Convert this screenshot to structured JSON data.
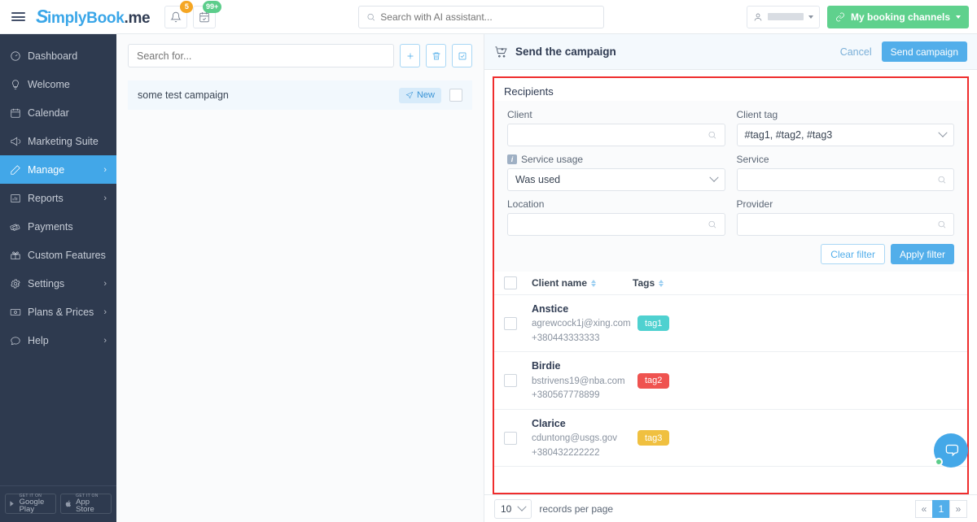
{
  "header": {
    "logo": {
      "s": "S",
      "blue": "imply",
      "bold_blue": "Book",
      "dark": ".me"
    },
    "menu_icon": "hamburger-icon",
    "notifications": {
      "icon": "bell-icon",
      "count": "5"
    },
    "bookings": {
      "icon": "calendar-check-icon",
      "count": "99+"
    },
    "search": {
      "placeholder": "Search with AI assistant...",
      "value": "",
      "icon": "search-icon"
    },
    "user": {
      "icon": "user-icon",
      "name": ""
    },
    "booking_channels": {
      "label": "My booking channels",
      "icon": "link-icon",
      "color": "#5fd18d"
    }
  },
  "sidebar": {
    "items": [
      {
        "label": "Dashboard",
        "icon": "speedometer-icon",
        "has_chevron": false,
        "active": false
      },
      {
        "label": "Welcome",
        "icon": "lightbulb-icon",
        "has_chevron": false,
        "active": false
      },
      {
        "label": "Calendar",
        "icon": "calendar-icon",
        "has_chevron": false,
        "active": false
      },
      {
        "label": "Marketing Suite",
        "icon": "megaphone-icon",
        "has_chevron": false,
        "active": false
      },
      {
        "label": "Manage",
        "icon": "pencil-icon",
        "has_chevron": true,
        "active": true
      },
      {
        "label": "Reports",
        "icon": "bar-chart-icon",
        "has_chevron": true,
        "active": false
      },
      {
        "label": "Payments",
        "icon": "money-icon",
        "has_chevron": false,
        "active": false
      },
      {
        "label": "Custom Features",
        "icon": "gift-icon",
        "has_chevron": false,
        "active": false
      },
      {
        "label": "Settings",
        "icon": "gear-icon",
        "has_chevron": true,
        "active": false
      },
      {
        "label": "Plans & Prices",
        "icon": "banknote-icon",
        "has_chevron": true,
        "active": false
      },
      {
        "label": "Help",
        "icon": "chat-icon",
        "has_chevron": true,
        "active": false
      }
    ],
    "chevron_glyph": "›",
    "stores": [
      {
        "top": "GET IT ON",
        "name": "Google Play",
        "icon": "google-play-icon"
      },
      {
        "top": "GET IT ON",
        "name": "App Store",
        "icon": "apple-icon"
      }
    ],
    "active_color": "#42a7e8",
    "background": "#2e3a4f"
  },
  "campaign_list": {
    "search": {
      "placeholder": "Search for...",
      "value": ""
    },
    "actions": [
      {
        "name": "add-campaign-button",
        "icon": "plus-icon"
      },
      {
        "name": "delete-campaign-button",
        "icon": "trash-icon"
      },
      {
        "name": "select-all-button",
        "icon": "checkbox-square-icon"
      }
    ],
    "rows": [
      {
        "name": "some test campaign",
        "status": "New",
        "status_icon": "paper-plane-icon",
        "checked": false
      }
    ]
  },
  "panel": {
    "icon": "cart-plus-icon",
    "title": "Send the campaign",
    "cancel_label": "Cancel",
    "send_label": "Send campaign",
    "highlight_color": "#ef2d2d"
  },
  "recipients": {
    "title": "Recipients",
    "filters": {
      "client": {
        "label": "Client",
        "value": "",
        "icon": "search-icon"
      },
      "client_tag": {
        "label": "Client tag",
        "value": "#tag1, #tag2, #tag3",
        "icon": "chevron-down-icon"
      },
      "service_usage": {
        "label": "Service usage",
        "value": "Was used",
        "icon": "chevron-down-icon",
        "info_icon": "info-icon"
      },
      "service": {
        "label": "Service",
        "value": "",
        "icon": "search-icon"
      },
      "location": {
        "label": "Location",
        "value": "",
        "icon": "search-icon"
      },
      "provider": {
        "label": "Provider",
        "value": "",
        "icon": "search-icon"
      }
    },
    "clear_filter_label": "Clear filter",
    "apply_filter_label": "Apply filter",
    "table": {
      "columns": [
        {
          "label": "Client name",
          "sortable": true
        },
        {
          "label": "Tags",
          "sortable": true
        }
      ],
      "select_all_checked": false,
      "rows": [
        {
          "name": "Anstice",
          "email": "agrewcock1j@xing.com",
          "phone": "+380443333333",
          "tag": "tag1",
          "tag_color": "#4fd1d0",
          "checked": false
        },
        {
          "name": "Birdie",
          "email": "bstrivens19@nba.com",
          "phone": "+380567778899",
          "tag": "tag2",
          "tag_color": "#ef5350",
          "checked": false
        },
        {
          "name": "Clarice",
          "email": "cduntong@usgs.gov",
          "phone": "+380432222222",
          "tag": "tag3",
          "tag_color": "#f0c040",
          "checked": false
        }
      ]
    }
  },
  "footer": {
    "records_per_page_value": "10",
    "records_per_page_label": "records per page",
    "pagination": {
      "prev": "«",
      "pages": [
        "1"
      ],
      "next": "»",
      "current": "1"
    }
  },
  "chat_widget": {
    "icon": "chat-bubbles-icon",
    "online": true,
    "color": "#44a8e8"
  }
}
